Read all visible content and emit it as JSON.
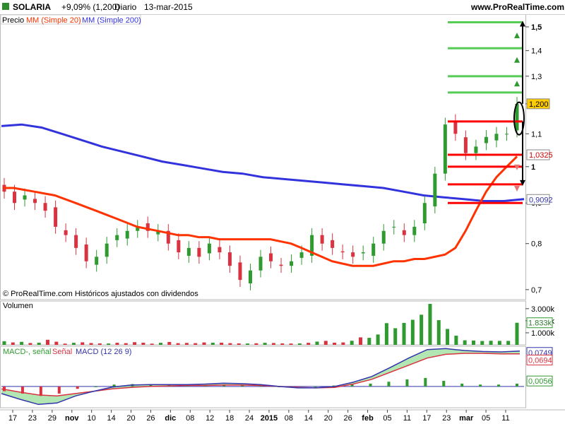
{
  "header": {
    "symbol": "SOLARIA",
    "change": "+9,09% (1,200)",
    "period": "Diario",
    "date": "13-mar-2015",
    "site": "www.ProRealTime.com"
  },
  "panels": {
    "price": {
      "legend": [
        "Precio",
        "MM (Simple 20)",
        "MM (Simple 200)"
      ],
      "footer": "© ProRealTime.com  Históricos ajustados con dividendos"
    },
    "volume": {
      "legend": "Volumen"
    },
    "macd": {
      "legend": [
        "MACD-, señal",
        "Señal",
        "MACD (12 26 9)"
      ]
    }
  },
  "colors": {
    "bull": "#2f9a2f",
    "bear": "#d93240",
    "ma20": "#ff3300",
    "ma200": "#3333dd",
    "target_line_up": "#55cc55",
    "target_line_down": "#ff0000",
    "current_label_bg": "#ffcc00"
  },
  "chart_data": [
    {
      "type": "candlestick",
      "title": "SOLARIA",
      "ylim": [
        0.68,
        1.55
      ],
      "yscale": "log",
      "y_ticks": [
        "0,7",
        "0,8",
        "0,9",
        "1",
        "1,1",
        "1,2",
        "1,3",
        "1,4",
        "1,5"
      ],
      "x_tick_labels": [
        "17",
        "23",
        "29",
        "nov",
        "10",
        "14",
        "20",
        "26",
        "dic",
        "08",
        "12",
        "18",
        "24",
        "2015",
        "08",
        "14",
        "20",
        "26",
        "feb",
        "05",
        "11",
        "17",
        "23",
        "mar",
        "05",
        "11"
      ],
      "price_labels": {
        "current": "1,200",
        "ma20": "1,0325",
        "ma200": "0,9092"
      },
      "price_levels": [
        0.9,
        0.95,
        1.0,
        1.035,
        1.14,
        1.24,
        1.3,
        1.41,
        1.52
      ],
      "series": [
        {
          "name": "MM (Simple 20)",
          "values": [
            0.94,
            0.94,
            0.935,
            0.93,
            0.925,
            0.92,
            0.91,
            0.9,
            0.89,
            0.88,
            0.87,
            0.86,
            0.85,
            0.84,
            0.835,
            0.83,
            0.825,
            0.82,
            0.82,
            0.815,
            0.815,
            0.81,
            0.81,
            0.81,
            0.81,
            0.81,
            0.81,
            0.805,
            0.8,
            0.79,
            0.78,
            0.77,
            0.76,
            0.755,
            0.75,
            0.75,
            0.75,
            0.755,
            0.76,
            0.76,
            0.765,
            0.765,
            0.77,
            0.775,
            0.79,
            0.83,
            0.88,
            0.93,
            0.97,
            1.0,
            1.03
          ]
        },
        {
          "name": "MM (Simple 200)",
          "values": [
            1.125,
            1.13,
            1.12,
            1.1,
            1.08,
            1.06,
            1.045,
            1.03,
            1.015,
            1.005,
            0.995,
            0.985,
            0.98,
            0.97,
            0.965,
            0.96,
            0.955,
            0.95,
            0.945,
            0.94,
            0.93,
            0.92,
            0.915,
            0.91,
            0.905,
            0.905,
            0.91
          ]
        },
        {
          "name": "Precio (cierre)",
          "values": [
            0.93,
            0.9,
            0.92,
            0.9,
            0.88,
            0.84,
            0.82,
            0.79,
            0.76,
            0.77,
            0.8,
            0.82,
            0.83,
            0.84,
            0.83,
            0.83,
            0.8,
            0.78,
            0.79,
            0.77,
            0.8,
            0.78,
            0.75,
            0.72,
            0.74,
            0.77,
            0.76,
            0.75,
            0.76,
            0.78,
            0.82,
            0.8,
            0.79,
            0.78,
            0.77,
            0.78,
            0.8,
            0.83,
            0.84,
            0.82,
            0.84,
            0.9,
            0.98,
            1.13,
            1.1,
            1.04,
            1.06,
            1.09,
            1.1,
            1.1,
            1.2
          ]
        }
      ]
    },
    {
      "type": "bar",
      "title": "Volumen",
      "y_ticks": [
        "1.000k",
        "2.000k",
        "3.000k"
      ],
      "last_value": "1.833k",
      "ylim": [
        0,
        3400
      ],
      "values": [
        300,
        200,
        250,
        150,
        180,
        420,
        260,
        100,
        170,
        210,
        150,
        120,
        110,
        170,
        140,
        220,
        180,
        100,
        170,
        240,
        140,
        160,
        140,
        200,
        180,
        180,
        140,
        120,
        110,
        130,
        170,
        150,
        120,
        110,
        120,
        170,
        270,
        330,
        180,
        200,
        340,
        620,
        580,
        860,
        1800,
        1380,
        1820,
        2080,
        2500,
        3400,
        2050,
        1320,
        760,
        380,
        360,
        320,
        340,
        330,
        330,
        1833
      ]
    },
    {
      "type": "area",
      "title": "MACD (12 26 9)",
      "value_labels": {
        "macd": "0,0749",
        "signal": "0,0694",
        "histogram": "0,0056"
      },
      "series": [
        {
          "name": "MACD-, señal",
          "values": [
            -0.01,
            -0.015,
            -0.02,
            -0.015,
            -0.005,
            0.0,
            0.004,
            0.005,
            0.004,
            0.003,
            0.002,
            0.003,
            0.004,
            0.003,
            0.002,
            0.0,
            -0.001,
            0.0,
            0.002,
            0.004,
            0.006,
            0.01,
            0.015,
            0.018,
            0.012,
            0.006,
            0.004,
            0.004,
            0.006
          ]
        },
        {
          "name": "Señal",
          "values": [
            -0.005,
            -0.012,
            -0.018,
            -0.02,
            -0.015,
            -0.01,
            -0.005,
            -0.002,
            0.0,
            0.001,
            0.002,
            0.002,
            0.003,
            0.003,
            0.002,
            0.0,
            -0.002,
            -0.003,
            -0.002,
            0.005,
            0.015,
            0.03,
            0.045,
            0.06,
            0.068,
            0.07,
            0.07,
            0.069,
            0.069
          ]
        },
        {
          "name": "MACD (12 26 9)",
          "values": [
            -0.015,
            -0.027,
            -0.038,
            -0.035,
            -0.02,
            -0.01,
            -0.001,
            0.003,
            0.004,
            0.004,
            0.004,
            0.005,
            0.007,
            0.006,
            0.004,
            0.0,
            -0.003,
            -0.003,
            0.0,
            0.009,
            0.021,
            0.04,
            0.06,
            0.078,
            0.08,
            0.076,
            0.074,
            0.073,
            0.075
          ]
        }
      ]
    }
  ]
}
